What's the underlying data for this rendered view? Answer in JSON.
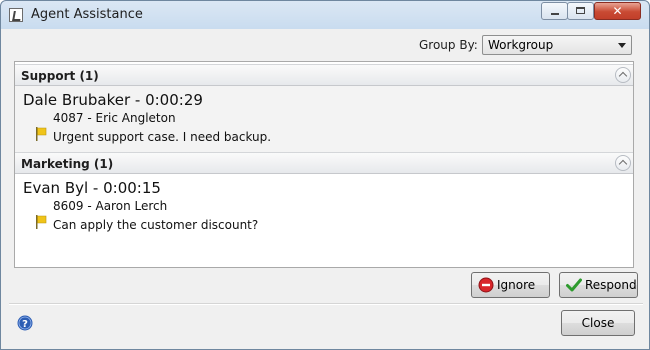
{
  "window": {
    "title": "Agent Assistance",
    "controls": {
      "minimize_icon": "minimize-icon",
      "maximize_icon": "maximize-icon",
      "close_glyph": "✕"
    }
  },
  "toolbar": {
    "groupby_label": "Group By:",
    "groupby_value": "Workgroup"
  },
  "groups": [
    {
      "header": "Support (1)",
      "selected": true,
      "agent": "Dale Brubaker - 0:00:29",
      "detail": "4087 - Eric Angleton",
      "message": "Urgent support case.  I need backup.",
      "icon": "flag-icon"
    },
    {
      "header": "Marketing (1)",
      "selected": false,
      "agent": "Evan Byl - 0:00:15",
      "detail": "8609 - Aaron Lerch",
      "message": "Can apply the customer discount?",
      "icon": "flag-icon"
    }
  ],
  "actions": {
    "ignore_label": "Ignore",
    "respond_label": "Respond",
    "close_label": "Close"
  },
  "colors": {
    "ignore_icon": "#d9262b",
    "respond_icon": "#2e9b2e",
    "flag": "#f0c419",
    "help": "#2c5db4"
  }
}
